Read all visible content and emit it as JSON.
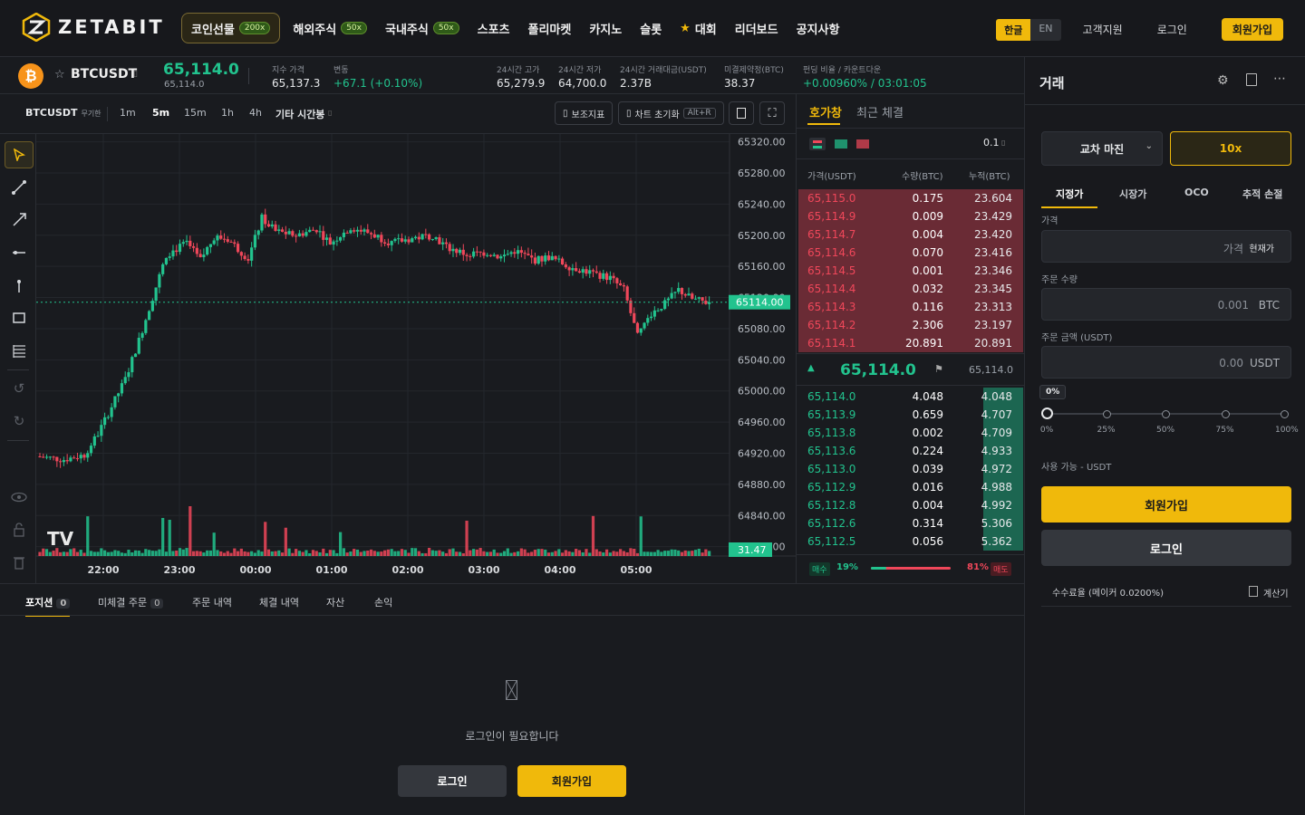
{
  "nav": {
    "brand": "ZETABIT",
    "menu": [
      {
        "label": "코인선물",
        "badge": "200x",
        "active": true
      },
      {
        "label": "해외주식",
        "badge": "50x"
      },
      {
        "label": "국내주식",
        "badge": "50x"
      },
      {
        "label": "스포츠"
      },
      {
        "label": "폴리마켓"
      },
      {
        "label": "카지노"
      },
      {
        "label": "슬롯"
      },
      {
        "label": "대회",
        "icon": "star-icon"
      },
      {
        "label": "리더보드"
      },
      {
        "label": "공지사항"
      }
    ],
    "lang_ko": "한글",
    "lang_en": "EN",
    "support": "고객지원",
    "login": "로그인",
    "signup": "회원가입"
  },
  "ticker": {
    "symbol": "BTCUSDT",
    "coin_glyph": "₿",
    "price": "65,114.0",
    "price_sub": "65,114.0",
    "stats": [
      {
        "label": "지수 가격",
        "value": "65,137.3"
      },
      {
        "label": "변동",
        "value": "+67.1 (+0.10%)",
        "color": "#22c38e"
      },
      {
        "label": "24시간 고가",
        "value": "65,279.9"
      },
      {
        "label": "24시간 저가",
        "value": "64,700.0"
      },
      {
        "label": "24시간 거래대금(USDT)",
        "value": "2.37B"
      },
      {
        "label": "미결제약정(BTC)",
        "value": "38.37"
      },
      {
        "label": "펀딩 비율 / 카운트다운",
        "value": "+0.00960% / 03:01:05",
        "color": "#22c38e"
      }
    ]
  },
  "chartbar": {
    "symbol": "BTCUSDT",
    "symbol_sub": "무기한",
    "timeframes": [
      "1m",
      "5m",
      "15m",
      "1h",
      "4h"
    ],
    "active_tf": "5m",
    "other_tf": "기타 시간봉",
    "indicators": "보조지표",
    "reset": "차트 초기화",
    "reset_kbd": "Alt+R"
  },
  "chart_data": {
    "type": "candlestick",
    "interval": "5m",
    "yaxis_ticks": [
      65320,
      65280,
      65240,
      65200,
      65160,
      65120,
      65080,
      65040,
      65000,
      64960,
      64920,
      64880,
      64840,
      64800
    ],
    "ylim": [
      64788,
      65330
    ],
    "xaxis_ticks": [
      "22:00",
      "23:00",
      "00:00",
      "01:00",
      "02:00",
      "03:00",
      "04:00",
      "05:00"
    ],
    "last_price_label": "65114.00",
    "volume_label": "31.47",
    "watermark": "TV",
    "colors": {
      "up": "#22c38e",
      "down": "#f0475a"
    }
  },
  "orderbook": {
    "tab_book": "호가창",
    "tab_trades": "최근 체결",
    "tick": "0.1",
    "headers": [
      "가격(USDT)",
      "수량(BTC)",
      "누적(BTC)"
    ],
    "asks": [
      {
        "price": "65,115.0",
        "qty": "0.175",
        "total": "23.604"
      },
      {
        "price": "65,114.9",
        "qty": "0.009",
        "total": "23.429"
      },
      {
        "price": "65,114.7",
        "qty": "0.004",
        "total": "23.420"
      },
      {
        "price": "65,114.6",
        "qty": "0.070",
        "total": "23.416"
      },
      {
        "price": "65,114.5",
        "qty": "0.001",
        "total": "23.346"
      },
      {
        "price": "65,114.4",
        "qty": "0.032",
        "total": "23.345"
      },
      {
        "price": "65,114.3",
        "qty": "0.116",
        "total": "23.313"
      },
      {
        "price": "65,114.2",
        "qty": "2.306",
        "total": "23.197"
      },
      {
        "price": "65,114.1",
        "qty": "20.891",
        "total": "20.891"
      }
    ],
    "mid_price": "65,114.0",
    "mid_index": "65,114.0",
    "bids": [
      {
        "price": "65,114.0",
        "qty": "4.048",
        "total": "4.048"
      },
      {
        "price": "65,113.9",
        "qty": "0.659",
        "total": "4.707"
      },
      {
        "price": "65,113.8",
        "qty": "0.002",
        "total": "4.709"
      },
      {
        "price": "65,113.6",
        "qty": "0.224",
        "total": "4.933"
      },
      {
        "price": "65,113.0",
        "qty": "0.039",
        "total": "4.972"
      },
      {
        "price": "65,112.9",
        "qty": "0.016",
        "total": "4.988"
      },
      {
        "price": "65,112.8",
        "qty": "0.004",
        "total": "4.992"
      },
      {
        "price": "65,112.6",
        "qty": "0.314",
        "total": "5.306"
      },
      {
        "price": "65,112.5",
        "qty": "0.056",
        "total": "5.362"
      }
    ],
    "buy_label": "매수",
    "buy_pct": "19%",
    "sell_pct": "81%",
    "sell_label": "매도",
    "buy_ratio": 0.19
  },
  "bottom": {
    "tabs": [
      {
        "label": "포지션",
        "count": "0",
        "active": true
      },
      {
        "label": "미체결 주문",
        "count": "0"
      },
      {
        "label": "주문 내역"
      },
      {
        "label": "체결 내역"
      },
      {
        "label": "자산"
      },
      {
        "label": "손익"
      }
    ],
    "login_required": "로그인이 필요합니다",
    "login": "로그인",
    "signup": "회원가입"
  },
  "trade": {
    "title": "거래",
    "margin_mode": "교차 마진",
    "leverage": "10x",
    "order_types": [
      "지정가",
      "시장가",
      "OCO",
      "추적 손절"
    ],
    "active_order_type": "지정가",
    "price_label": "가격",
    "price_placeholder": "가격",
    "price_btn": "현재가",
    "qty_label": "주문 수량",
    "qty_placeholder": "0.001",
    "qty_unit": "BTC",
    "amount_label": "주문 금액 (USDT)",
    "amount_placeholder": "0.00",
    "amount_unit": "USDT",
    "slider_value": "0%",
    "slider_marks": [
      "0%",
      "25%",
      "50%",
      "75%",
      "100%"
    ],
    "available": "사용 가능 - USDT",
    "signup": "회원가입",
    "login": "로그인",
    "fee": "수수료율 (메이커 0.0200%)",
    "calc": "계산기"
  }
}
